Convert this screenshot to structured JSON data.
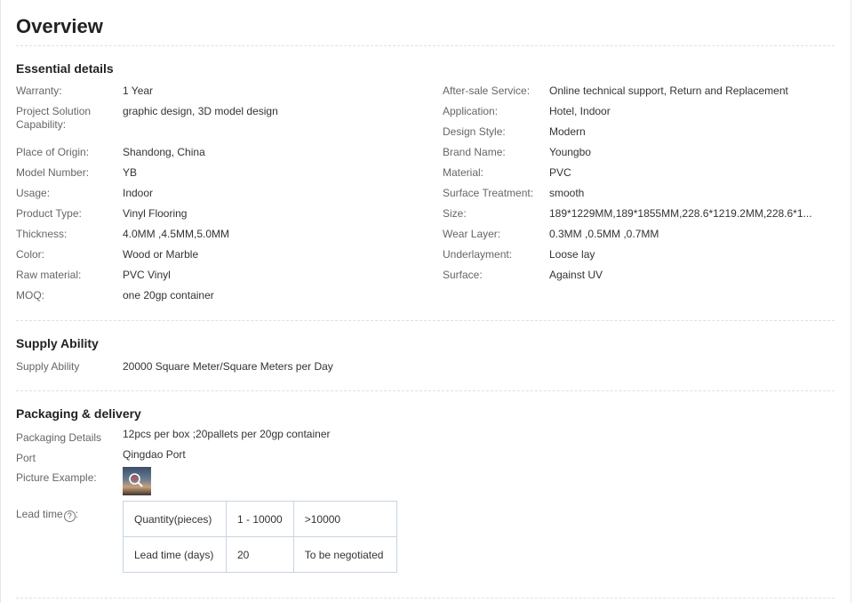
{
  "overview": {
    "title": "Overview"
  },
  "essential": {
    "title": "Essential details",
    "left": [
      {
        "label": "Warranty:",
        "value": "1 Year"
      },
      {
        "label": "Project Solution Capability:",
        "value": "graphic design, 3D model design"
      },
      {
        "label": "Place of Origin:",
        "value": "Shandong, China"
      },
      {
        "label": "Model Number:",
        "value": "YB"
      },
      {
        "label": "Usage:",
        "value": "Indoor"
      },
      {
        "label": "Product Type:",
        "value": "Vinyl Flooring"
      },
      {
        "label": "Thickness:",
        "value": "4.0MM ,4.5MM,5.0MM"
      },
      {
        "label": "Color:",
        "value": "Wood or Marble"
      },
      {
        "label": "Raw material:",
        "value": "PVC Vinyl"
      },
      {
        "label": "MOQ:",
        "value": "one 20gp container"
      }
    ],
    "right": [
      {
        "label": "After-sale Service:",
        "value": "Online technical support, Return and Replacement"
      },
      {
        "label": "Application:",
        "value": "Hotel, Indoor"
      },
      {
        "label": "Design Style:",
        "value": "Modern"
      },
      {
        "label": "Brand Name:",
        "value": "Youngbo"
      },
      {
        "label": "Material:",
        "value": "PVC"
      },
      {
        "label": "Surface Treatment:",
        "value": "smooth"
      },
      {
        "label": "Size:",
        "value": "189*1229MM,189*1855MM,228.6*1219.2MM,228.6*1..."
      },
      {
        "label": "Wear Layer:",
        "value": "0.3MM ,0.5MM ,0.7MM"
      },
      {
        "label": "Underlayment:",
        "value": "Loose lay"
      },
      {
        "label": "Surface:",
        "value": "Against UV"
      }
    ]
  },
  "supply": {
    "title": "Supply Ability",
    "label": "Supply Ability",
    "value": "20000 Square Meter/Square Meters per Day"
  },
  "packaging": {
    "title": "Packaging & delivery",
    "details_label": "Packaging Details",
    "details_value": "12pcs per box ;20pallets per 20gp container",
    "port_label": "Port",
    "port_value": "Qingdao Port",
    "picture_label": "Picture Example:",
    "lead_label": "Lead time",
    "lead_help_glyph": "?",
    "lead_colon": ":",
    "lead_table": [
      [
        "Quantity(pieces)",
        "1 - 10000",
        ">10000"
      ],
      [
        "Lead time (days)",
        "20",
        "To be negotiated"
      ]
    ]
  },
  "icons": {
    "zoom": "zoom-in-icon",
    "help": "help-circle-icon"
  }
}
